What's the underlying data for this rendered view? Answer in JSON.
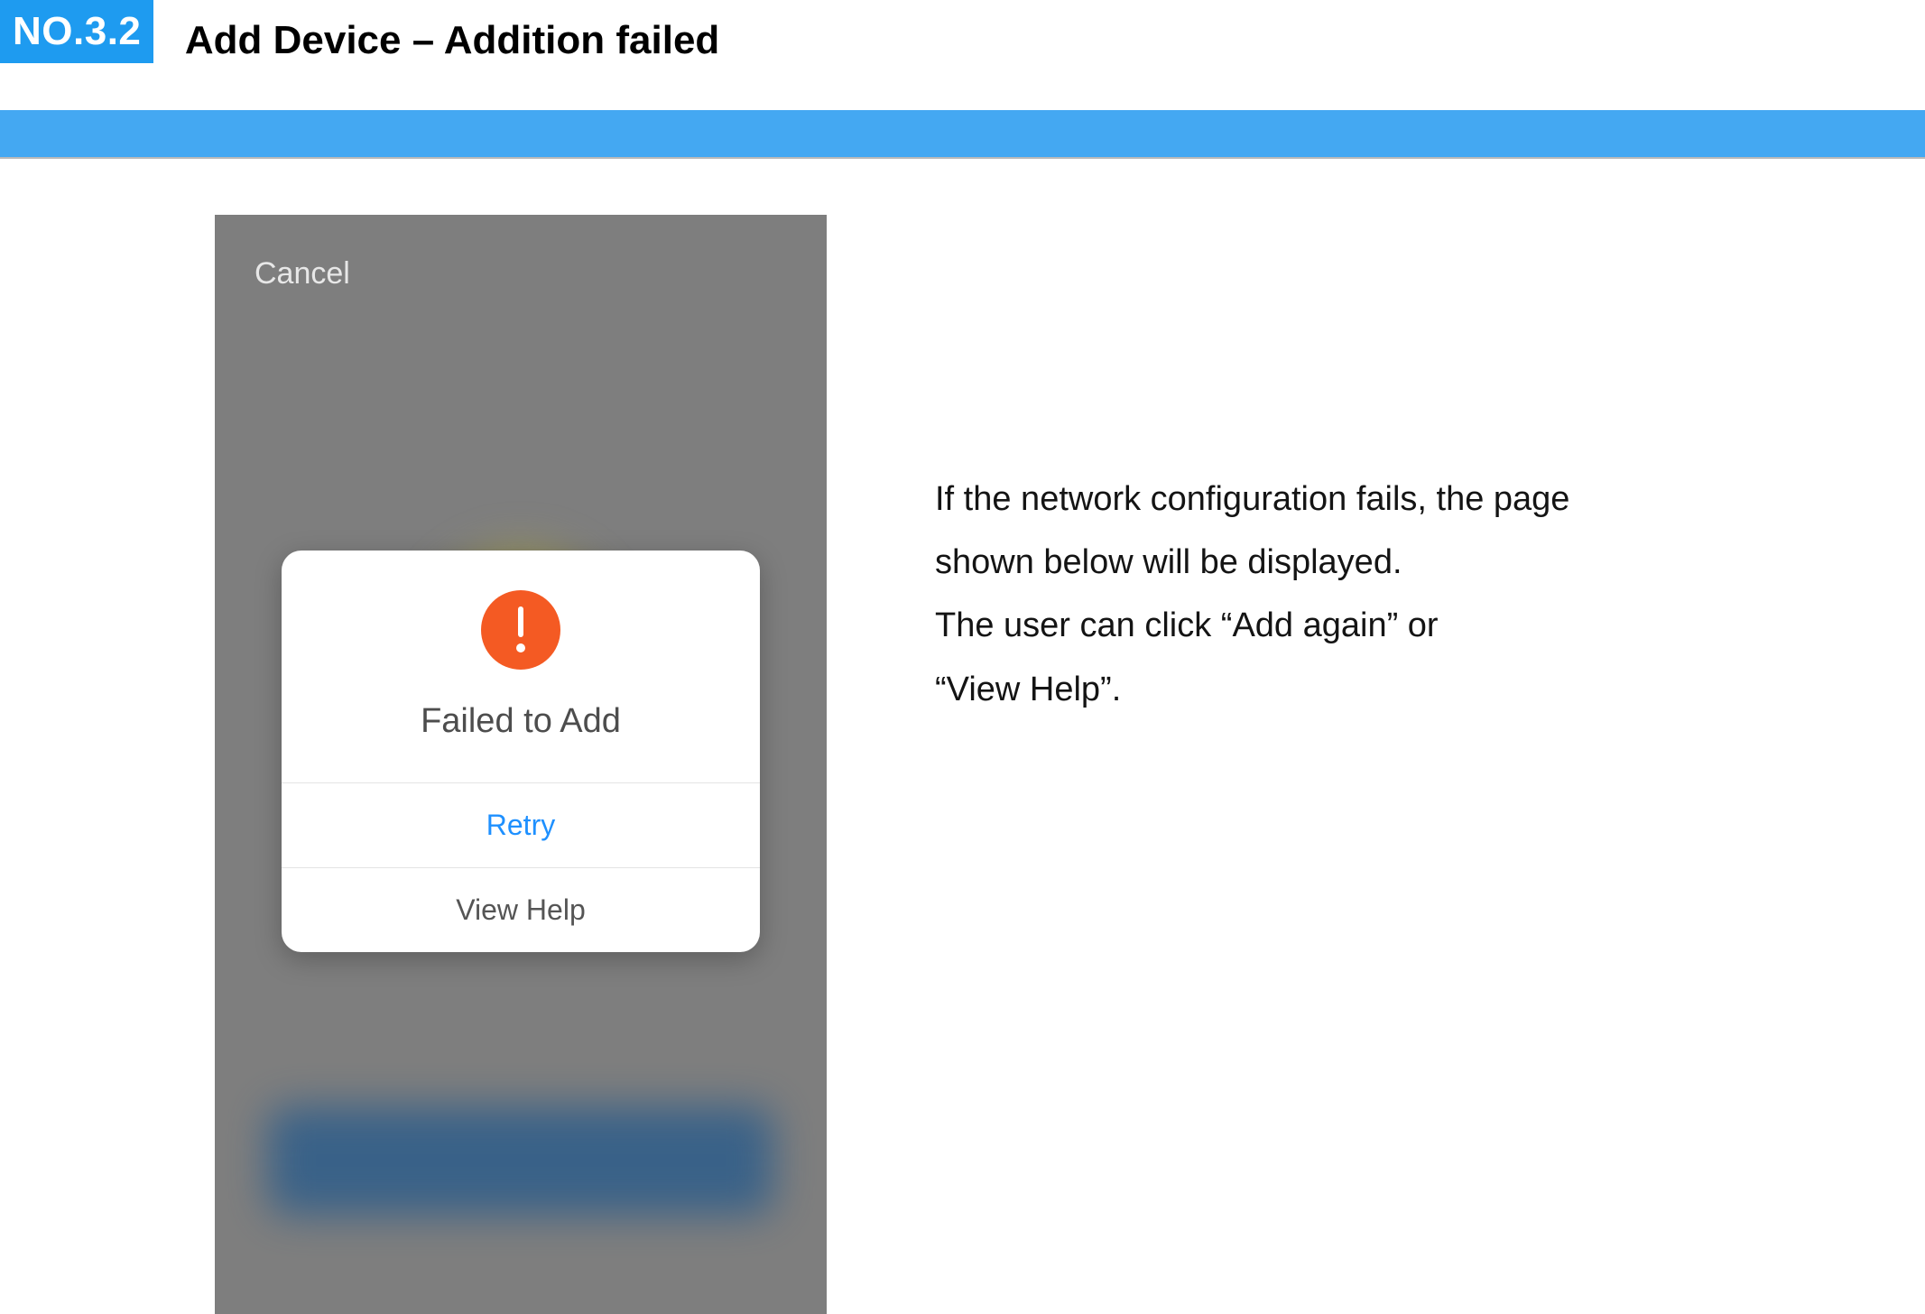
{
  "header": {
    "badge": "NO.3.2",
    "title": "Add Device – Addition failed"
  },
  "phone": {
    "cancel": "Cancel",
    "modal": {
      "icon": "alert-icon",
      "title": "Failed to Add",
      "retry": "Retry",
      "help": "View Help"
    }
  },
  "explain": {
    "line1": "If the network configuration fails, the page",
    "line2": "shown below will be displayed.",
    "line3": "The user can click “Add again” or",
    "line4": "“View Help”."
  }
}
